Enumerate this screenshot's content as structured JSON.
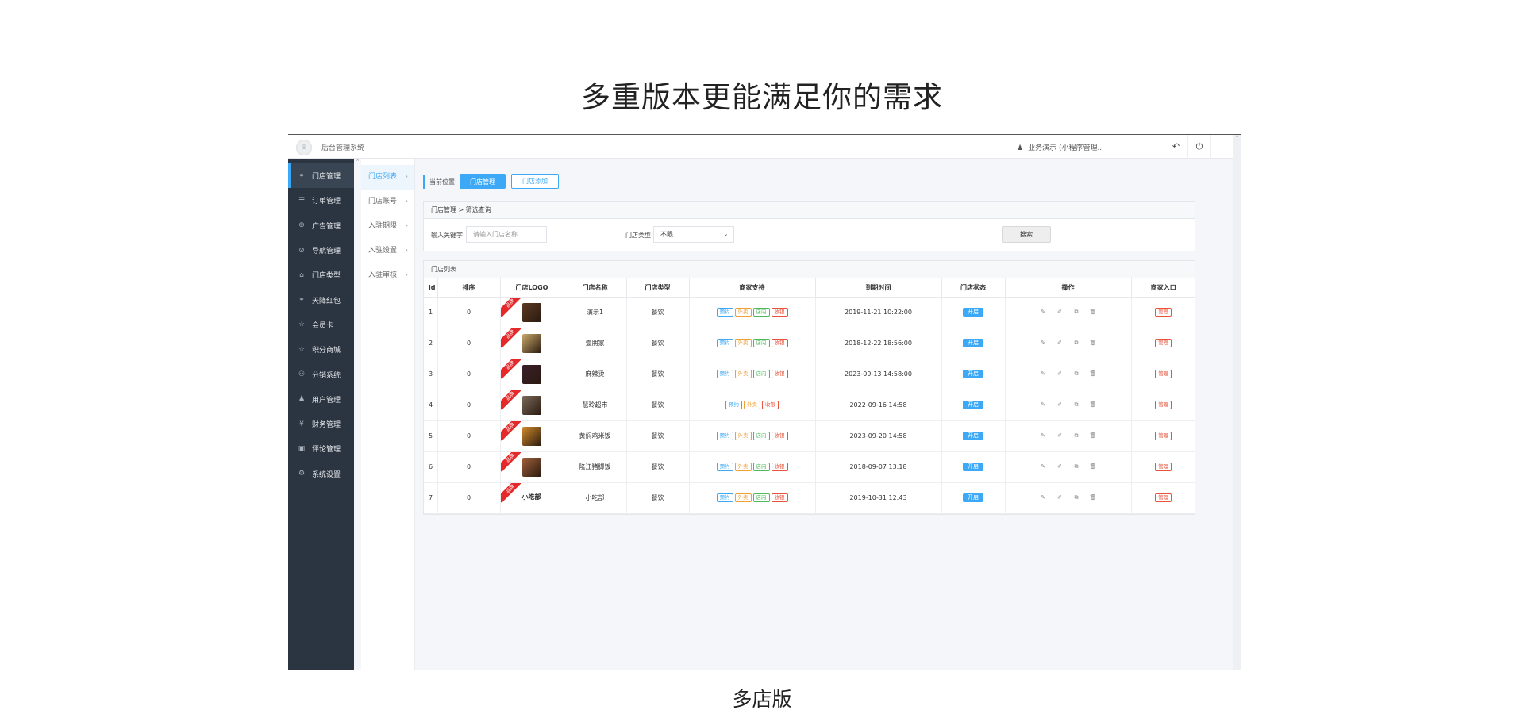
{
  "page": {
    "heading": "多重版本更能满足你的需求",
    "caption": "多店版"
  },
  "topbar": {
    "app_title": "后台管理系统",
    "user_label": "业务演示 (小程序管理...",
    "back_glyph": "↶",
    "power_glyph": "⏻"
  },
  "sidebar": {
    "items": [
      {
        "label": "门店管理",
        "icon": "store-icon",
        "glyph": "⚭",
        "active": true
      },
      {
        "label": "订单管理",
        "icon": "list-icon",
        "glyph": "☰"
      },
      {
        "label": "广告管理",
        "icon": "crosshair-icon",
        "glyph": "⊕"
      },
      {
        "label": "导航管理",
        "icon": "compass-icon",
        "glyph": "⊘"
      },
      {
        "label": "门店类型",
        "icon": "bank-icon",
        "glyph": "⌂"
      },
      {
        "label": "天降红包",
        "icon": "gift-icon",
        "glyph": "⚭"
      },
      {
        "label": "会员卡",
        "icon": "star-icon",
        "glyph": "☆"
      },
      {
        "label": "积分商城",
        "icon": "star-icon",
        "glyph": "☆"
      },
      {
        "label": "分销系统",
        "icon": "users-icon",
        "glyph": "⚇"
      },
      {
        "label": "用户管理",
        "icon": "user-icon",
        "glyph": "♟"
      },
      {
        "label": "财务管理",
        "icon": "yen-icon",
        "glyph": "¥"
      },
      {
        "label": "评论管理",
        "icon": "comment-icon",
        "glyph": "▣"
      },
      {
        "label": "系统设置",
        "icon": "gear-icon",
        "glyph": "⚙"
      }
    ]
  },
  "subnav": {
    "items": [
      {
        "label": "门店列表",
        "active": true
      },
      {
        "label": "门店账号"
      },
      {
        "label": "入驻期限"
      },
      {
        "label": "入驻设置"
      },
      {
        "label": "入驻审核"
      }
    ],
    "arrow": "›"
  },
  "breadcrumb": {
    "label": "当前位置:",
    "primary_button": "门店管理",
    "secondary_button": "门店添加"
  },
  "filter": {
    "title": "门店管理 > 筛选查询",
    "keyword_label": "输入关键字:",
    "keyword_placeholder": "请输入门店名称",
    "type_label": "门店类型:",
    "type_value": "不限",
    "search_button": "搜索"
  },
  "table": {
    "title": "门店列表",
    "headers": [
      "id",
      "排序",
      "门店LOGO",
      "门店名称",
      "门店类型",
      "商家支持",
      "到期时间",
      "门店状态",
      "操作",
      "商家入口"
    ],
    "ribbon_label": "品牌",
    "status_label": "开启",
    "manage_label": "管理",
    "rows": [
      {
        "id": "1",
        "sort": "0",
        "name": "演示1",
        "type": "餐饮",
        "tags": [
          "预约",
          "外卖",
          "店内",
          "收银"
        ],
        "expire": "2019-11-21 10:22:00",
        "thumb_color": "#5a3a22"
      },
      {
        "id": "2",
        "sort": "0",
        "name": "壹朋家",
        "type": "餐饮",
        "tags": [
          "预约",
          "外卖",
          "店内",
          "收银"
        ],
        "expire": "2018-12-22 18:56:00",
        "thumb_color": "#c9a96a"
      },
      {
        "id": "3",
        "sort": "0",
        "name": "麻辣烫",
        "type": "餐饮",
        "tags": [
          "预约",
          "外卖",
          "店内",
          "收银"
        ],
        "expire": "2023-09-13 14:58:00",
        "thumb_color": "#3a1f2a"
      },
      {
        "id": "4",
        "sort": "0",
        "name": "慧玲超市",
        "type": "餐饮",
        "tags": [
          "预约",
          "外卖",
          "收银"
        ],
        "expire": "2022-09-16 14:58",
        "thumb_color": "#7a6a5a"
      },
      {
        "id": "5",
        "sort": "0",
        "name": "黄焖鸡米饭",
        "type": "餐饮",
        "tags": [
          "预约",
          "外卖",
          "店内",
          "收银"
        ],
        "expire": "2023-09-20 14:58",
        "thumb_color": "#d08a2a"
      },
      {
        "id": "6",
        "sort": "0",
        "name": "隆江猪脚饭",
        "type": "餐饮",
        "tags": [
          "预约",
          "外卖",
          "店内",
          "收银"
        ],
        "expire": "2018-09-07 13:18",
        "thumb_color": "#a0603a"
      },
      {
        "id": "7",
        "sort": "0",
        "name": "小吃部",
        "type": "餐饮",
        "tags": [
          "预约",
          "外卖",
          "店内",
          "收银"
        ],
        "expire": "2019-10-31 12:43",
        "thumb_text": "小吃部"
      }
    ],
    "ops": [
      {
        "icon": "pencil-icon",
        "glyph": "✎"
      },
      {
        "icon": "edit-icon",
        "glyph": "✐"
      },
      {
        "icon": "copy-icon",
        "glyph": "⧉"
      },
      {
        "icon": "trash-icon",
        "glyph": "🗑"
      }
    ],
    "tag_colors": {
      "预约": "blue",
      "外卖": "orange",
      "店内": "green",
      "收银": "red"
    }
  },
  "colors": {
    "accent": "#3da8f5",
    "sidebar_bg": "#2b3441",
    "ribbon": "#e5282a"
  }
}
